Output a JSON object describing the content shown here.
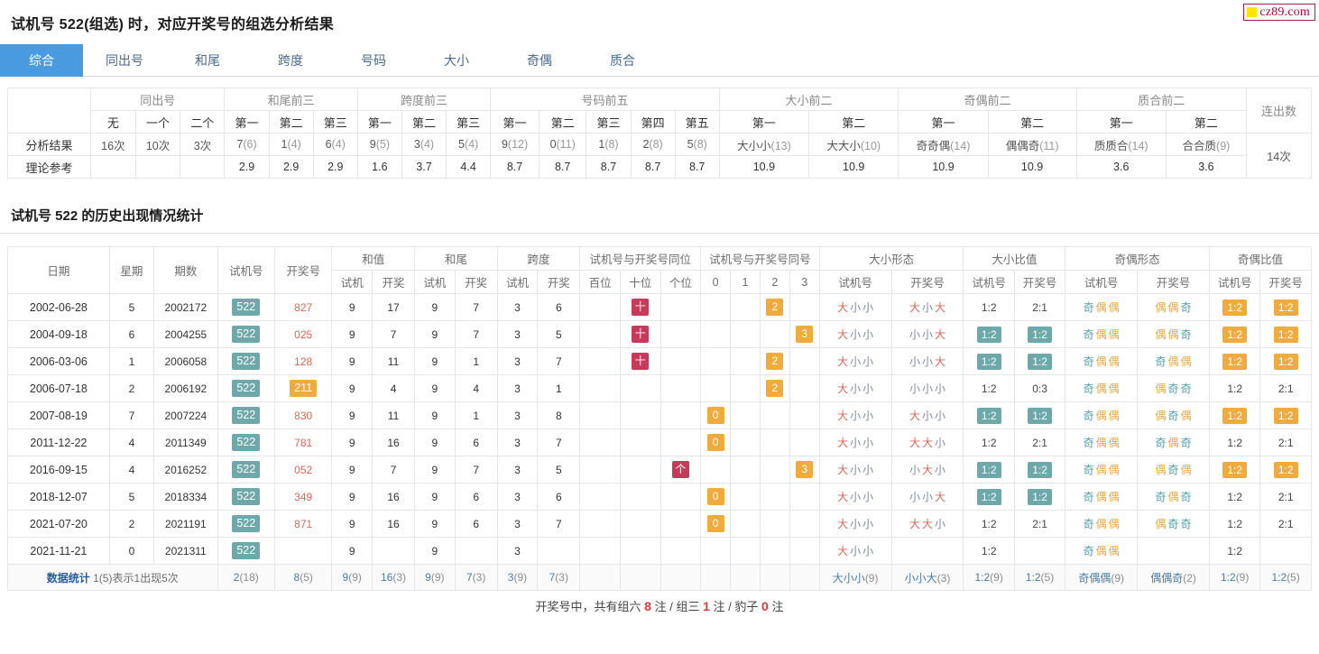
{
  "logo": {
    "text": "cz89.com",
    "square_color": "#ffe600",
    "border_color": "#b01f4a",
    "text_color": "#c00038"
  },
  "page_title": "试机号 522(组选) 时，对应开奖号的组选分析结果",
  "tabs": [
    {
      "label": "综合",
      "active": true
    },
    {
      "label": "同出号",
      "active": false
    },
    {
      "label": "和尾",
      "active": false
    },
    {
      "label": "跨度",
      "active": false
    },
    {
      "label": "号码",
      "active": false
    },
    {
      "label": "大小",
      "active": false
    },
    {
      "label": "奇偶",
      "active": false
    },
    {
      "label": "质合",
      "active": false
    }
  ],
  "summary_table": {
    "groups": [
      {
        "label": "同出号",
        "span": 3
      },
      {
        "label": "和尾前三",
        "span": 3
      },
      {
        "label": "跨度前三",
        "span": 3
      },
      {
        "label": "号码前五",
        "span": 5
      },
      {
        "label": "大小前二",
        "span": 2
      },
      {
        "label": "奇偶前二",
        "span": 2
      },
      {
        "label": "质合前二",
        "span": 2
      },
      {
        "label": "连出数",
        "span": 1
      }
    ],
    "subheaders": [
      "无",
      "一个",
      "二个",
      "第一",
      "第二",
      "第三",
      "第一",
      "第二",
      "第三",
      "第一",
      "第二",
      "第三",
      "第四",
      "第五",
      "第一",
      "第二",
      "第一",
      "第二",
      "第一",
      "第二"
    ],
    "row_labels": [
      "分析结果",
      "理论参考"
    ],
    "analysis": [
      {
        "main": "16次",
        "sub": ""
      },
      {
        "main": "10次",
        "sub": ""
      },
      {
        "main": "3次",
        "sub": ""
      },
      {
        "main": "7",
        "sub": "(6)"
      },
      {
        "main": "1",
        "sub": "(4)"
      },
      {
        "main": "6",
        "sub": "(4)"
      },
      {
        "main": "9",
        "sub": "(5)"
      },
      {
        "main": "3",
        "sub": "(4)"
      },
      {
        "main": "5",
        "sub": "(4)"
      },
      {
        "main": "9",
        "sub": "(12)"
      },
      {
        "main": "0",
        "sub": "(11)"
      },
      {
        "main": "1",
        "sub": "(8)"
      },
      {
        "main": "2",
        "sub": "(8)"
      },
      {
        "main": "5",
        "sub": "(8)"
      },
      {
        "main": "大小小",
        "sub": "(13)"
      },
      {
        "main": "大大小",
        "sub": "(10)"
      },
      {
        "main": "奇奇偶",
        "sub": "(14)"
      },
      {
        "main": "偶偶奇",
        "sub": "(11)"
      },
      {
        "main": "质质合",
        "sub": "(14)"
      },
      {
        "main": "合合质",
        "sub": "(9)"
      }
    ],
    "connect_count": "14次",
    "theory": [
      "",
      "",
      "",
      "2.9",
      "2.9",
      "2.9",
      "1.6",
      "3.7",
      "4.4",
      "8.7",
      "8.7",
      "8.7",
      "8.7",
      "8.7",
      "10.9",
      "10.9",
      "10.9",
      "10.9",
      "3.6",
      "3.6"
    ]
  },
  "section_title": "试机号 522 的历史出现情况统计",
  "history_table": {
    "group_headers": [
      {
        "label": "日期",
        "span": 1,
        "rowspan": 2
      },
      {
        "label": "星期",
        "span": 1,
        "rowspan": 2
      },
      {
        "label": "期数",
        "span": 1,
        "rowspan": 2
      },
      {
        "label": "试机号",
        "span": 1,
        "rowspan": 2
      },
      {
        "label": "开奖号",
        "span": 1,
        "rowspan": 2
      },
      {
        "label": "和值",
        "span": 2
      },
      {
        "label": "和尾",
        "span": 2
      },
      {
        "label": "跨度",
        "span": 2
      },
      {
        "label": "试机号与开奖号同位",
        "span": 3
      },
      {
        "label": "试机号与开奖号同号",
        "span": 4
      },
      {
        "label": "大小形态",
        "span": 2
      },
      {
        "label": "大小比值",
        "span": 2
      },
      {
        "label": "奇偶形态",
        "span": 2
      },
      {
        "label": "奇偶比值",
        "span": 2
      }
    ],
    "sub_headers": [
      "试机",
      "开奖",
      "试机",
      "开奖",
      "试机",
      "开奖",
      "百位",
      "十位",
      "个位",
      "0",
      "1",
      "2",
      "3",
      "试机号",
      "开奖号",
      "试机号",
      "开奖号",
      "试机号",
      "开奖号",
      "试机号",
      "开奖号"
    ],
    "rows": [
      {
        "date": "2002-06-28",
        "week": "5",
        "issue": "2002172",
        "shiji": "522",
        "kaijiang": "827",
        "kaijiang_hl": false,
        "hezhi_s": "9",
        "hezhi_k": "17",
        "hewei_s": "9",
        "hewei_k": "7",
        "kuadu_s": "3",
        "kuadu_k": "6",
        "tongwei": [
          "",
          "十",
          ""
        ],
        "tonghao": [
          "",
          "",
          "2",
          ""
        ],
        "dx_s": "大小小",
        "dx_k": "大小大",
        "dxr_s": "1:2",
        "dxr_s_hl": false,
        "dxr_k": "2:1",
        "dxr_k_hl": false,
        "jo_s": "奇偶偶",
        "jo_k": "偶偶奇",
        "jor_s": "1:2",
        "jor_s_hl": true,
        "jor_k": "1:2",
        "jor_k_hl": true
      },
      {
        "date": "2004-09-18",
        "week": "6",
        "issue": "2004255",
        "shiji": "522",
        "kaijiang": "025",
        "kaijiang_hl": false,
        "hezhi_s": "9",
        "hezhi_k": "7",
        "hewei_s": "9",
        "hewei_k": "7",
        "kuadu_s": "3",
        "kuadu_k": "5",
        "tongwei": [
          "",
          "十",
          ""
        ],
        "tonghao": [
          "",
          "",
          "",
          "3"
        ],
        "dx_s": "大小小",
        "dx_k": "小小大",
        "dxr_s": "1:2",
        "dxr_s_hl": true,
        "dxr_k": "1:2",
        "dxr_k_hl": true,
        "jo_s": "奇偶偶",
        "jo_k": "偶偶奇",
        "jor_s": "1:2",
        "jor_s_hl": true,
        "jor_k": "1:2",
        "jor_k_hl": true
      },
      {
        "date": "2006-03-06",
        "week": "1",
        "issue": "2006058",
        "shiji": "522",
        "kaijiang": "128",
        "kaijiang_hl": false,
        "hezhi_s": "9",
        "hezhi_k": "11",
        "hewei_s": "9",
        "hewei_k": "1",
        "kuadu_s": "3",
        "kuadu_k": "7",
        "tongwei": [
          "",
          "十",
          ""
        ],
        "tonghao": [
          "",
          "",
          "2",
          ""
        ],
        "dx_s": "大小小",
        "dx_k": "小小大",
        "dxr_s": "1:2",
        "dxr_s_hl": true,
        "dxr_k": "1:2",
        "dxr_k_hl": true,
        "jo_s": "奇偶偶",
        "jo_k": "奇偶偶",
        "jor_s": "1:2",
        "jor_s_hl": true,
        "jor_k": "1:2",
        "jor_k_hl": true
      },
      {
        "date": "2006-07-18",
        "week": "2",
        "issue": "2006192",
        "shiji": "522",
        "kaijiang": "211",
        "kaijiang_hl": true,
        "hezhi_s": "9",
        "hezhi_k": "4",
        "hewei_s": "9",
        "hewei_k": "4",
        "kuadu_s": "3",
        "kuadu_k": "1",
        "tongwei": [
          "",
          "",
          ""
        ],
        "tonghao": [
          "",
          "",
          "2",
          ""
        ],
        "dx_s": "大小小",
        "dx_k": "小小小",
        "dxr_s": "1:2",
        "dxr_s_hl": false,
        "dxr_k": "0:3",
        "dxr_k_hl": false,
        "jo_s": "奇偶偶",
        "jo_k": "偶奇奇",
        "jor_s": "1:2",
        "jor_s_hl": false,
        "jor_k": "2:1",
        "jor_k_hl": false
      },
      {
        "date": "2007-08-19",
        "week": "7",
        "issue": "2007224",
        "shiji": "522",
        "kaijiang": "830",
        "kaijiang_hl": false,
        "hezhi_s": "9",
        "hezhi_k": "11",
        "hewei_s": "9",
        "hewei_k": "1",
        "kuadu_s": "3",
        "kuadu_k": "8",
        "tongwei": [
          "",
          "",
          ""
        ],
        "tonghao": [
          "0",
          "",
          "",
          ""
        ],
        "dx_s": "大小小",
        "dx_k": "大小小",
        "dxr_s": "1:2",
        "dxr_s_hl": true,
        "dxr_k": "1:2",
        "dxr_k_hl": true,
        "jo_s": "奇偶偶",
        "jo_k": "偶奇偶",
        "jor_s": "1:2",
        "jor_s_hl": true,
        "jor_k": "1:2",
        "jor_k_hl": true
      },
      {
        "date": "2011-12-22",
        "week": "4",
        "issue": "2011349",
        "shiji": "522",
        "kaijiang": "781",
        "kaijiang_hl": false,
        "hezhi_s": "9",
        "hezhi_k": "16",
        "hewei_s": "9",
        "hewei_k": "6",
        "kuadu_s": "3",
        "kuadu_k": "7",
        "tongwei": [
          "",
          "",
          ""
        ],
        "tonghao": [
          "0",
          "",
          "",
          ""
        ],
        "dx_s": "大小小",
        "dx_k": "大大小",
        "dxr_s": "1:2",
        "dxr_s_hl": false,
        "dxr_k": "2:1",
        "dxr_k_hl": false,
        "jo_s": "奇偶偶",
        "jo_k": "奇偶奇",
        "jor_s": "1:2",
        "jor_s_hl": false,
        "jor_k": "2:1",
        "jor_k_hl": false
      },
      {
        "date": "2016-09-15",
        "week": "4",
        "issue": "2016252",
        "shiji": "522",
        "kaijiang": "052",
        "kaijiang_hl": false,
        "hezhi_s": "9",
        "hezhi_k": "7",
        "hewei_s": "9",
        "hewei_k": "7",
        "kuadu_s": "3",
        "kuadu_k": "5",
        "tongwei": [
          "",
          "",
          "个"
        ],
        "tonghao": [
          "",
          "",
          "",
          "3"
        ],
        "dx_s": "大小小",
        "dx_k": "小大小",
        "dxr_s": "1:2",
        "dxr_s_hl": true,
        "dxr_k": "1:2",
        "dxr_k_hl": true,
        "jo_s": "奇偶偶",
        "jo_k": "偶奇偶",
        "jor_s": "1:2",
        "jor_s_hl": true,
        "jor_k": "1:2",
        "jor_k_hl": true
      },
      {
        "date": "2018-12-07",
        "week": "5",
        "issue": "2018334",
        "shiji": "522",
        "kaijiang": "349",
        "kaijiang_hl": false,
        "hezhi_s": "9",
        "hezhi_k": "16",
        "hewei_s": "9",
        "hewei_k": "6",
        "kuadu_s": "3",
        "kuadu_k": "6",
        "tongwei": [
          "",
          "",
          ""
        ],
        "tonghao": [
          "0",
          "",
          "",
          ""
        ],
        "dx_s": "大小小",
        "dx_k": "小小大",
        "dxr_s": "1:2",
        "dxr_s_hl": true,
        "dxr_k": "1:2",
        "dxr_k_hl": true,
        "jo_s": "奇偶偶",
        "jo_k": "奇偶奇",
        "jor_s": "1:2",
        "jor_s_hl": false,
        "jor_k": "2:1",
        "jor_k_hl": false
      },
      {
        "date": "2021-07-20",
        "week": "2",
        "issue": "2021191",
        "shiji": "522",
        "kaijiang": "871",
        "kaijiang_hl": false,
        "hezhi_s": "9",
        "hezhi_k": "16",
        "hewei_s": "9",
        "hewei_k": "6",
        "kuadu_s": "3",
        "kuadu_k": "7",
        "tongwei": [
          "",
          "",
          ""
        ],
        "tonghao": [
          "0",
          "",
          "",
          ""
        ],
        "dx_s": "大小小",
        "dx_k": "大大小",
        "dxr_s": "1:2",
        "dxr_s_hl": false,
        "dxr_k": "2:1",
        "dxr_k_hl": false,
        "jo_s": "奇偶偶",
        "jo_k": "偶奇奇",
        "jor_s": "1:2",
        "jor_s_hl": false,
        "jor_k": "2:1",
        "jor_k_hl": false
      },
      {
        "date": "2021-11-21",
        "week": "0",
        "issue": "2021311",
        "shiji": "522",
        "kaijiang": "",
        "kaijiang_hl": false,
        "hezhi_s": "9",
        "hezhi_k": "",
        "hewei_s": "9",
        "hewei_k": "",
        "kuadu_s": "3",
        "kuadu_k": "",
        "tongwei": [
          "",
          "",
          ""
        ],
        "tonghao": [
          "",
          "",
          "",
          ""
        ],
        "dx_s": "大小小",
        "dx_k": "",
        "dxr_s": "1:2",
        "dxr_s_hl": false,
        "dxr_k": "",
        "dxr_k_hl": false,
        "jo_s": "奇偶偶",
        "jo_k": "",
        "jor_s": "1:2",
        "jor_s_hl": false,
        "jor_k": "",
        "jor_k_hl": false
      }
    ],
    "stats_row": {
      "label": "数据统计",
      "legend": "1(5)表示1出现5次",
      "shiji": "2(18)",
      "kaijiang": "8(5)",
      "hezhi_s": "9(9)",
      "hezhi_k": "16(3)",
      "hewei_s": "9(9)",
      "hewei_k": "7(3)",
      "kuadu_s": "3(9)",
      "kuadu_k": "7(3)",
      "dx_s": "大小小(9)",
      "dx_k": "小小大(3)",
      "dxr_s": "1:2(9)",
      "dxr_k": "1:2(5)",
      "jo_s": "奇偶偶(9)",
      "jo_k": "偶偶奇(2)",
      "jor_s": "1:2(9)",
      "jor_k": "1:2(5)"
    }
  },
  "footer": {
    "prefix": "开奖号中，共有组六",
    "zuliu": "8",
    "mid1": "注",
    "sep1": "/",
    "zusan_label": "组三",
    "zusan": "1",
    "mid2": "注",
    "sep2": "/",
    "baozi_label": "豹子",
    "baozi": "0",
    "suffix": "注"
  }
}
